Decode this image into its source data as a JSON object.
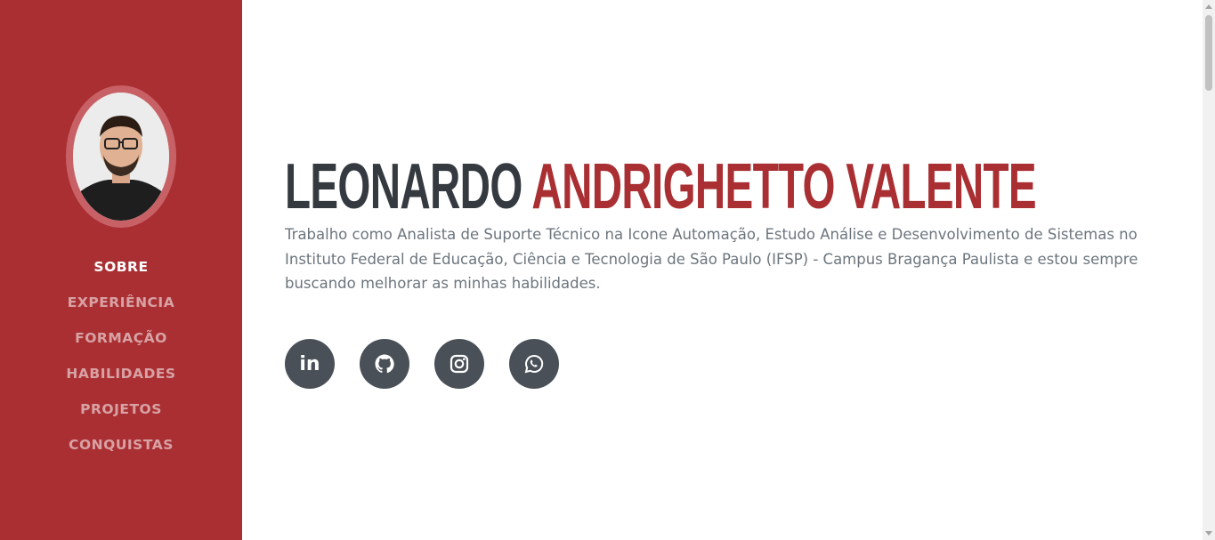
{
  "sidebar": {
    "nav": [
      {
        "label": "SOBRE",
        "active": true
      },
      {
        "label": "EXPERIÊNCIA"
      },
      {
        "label": "FORMAÇÃO"
      },
      {
        "label": "HABILIDADES"
      },
      {
        "label": "PROJETOS"
      },
      {
        "label": "CONQUISTAS"
      }
    ]
  },
  "main": {
    "first_name": "LEONARDO",
    "last_name": "ANDRIGHETTO VALENTE",
    "lead": "Trabalho como Analista de Suporte Técnico na Icone Automação, Estudo Análise e Desenvolvimento de Sistemas no Instituto Federal de Educação, Ciência e Tecnologia de São Paulo (IFSP) - Campus Bragança Paulista e estou sempre buscando melhorar as minhas habilidades.",
    "social": [
      {
        "name": "linkedin-icon",
        "text": "in"
      },
      {
        "name": "github-icon"
      },
      {
        "name": "instagram-icon"
      },
      {
        "name": "whatsapp-icon"
      }
    ]
  },
  "colors": {
    "primary": "#a92f33",
    "dark": "#343a40",
    "muted": "#6c757d",
    "social_bg": "#495057"
  }
}
